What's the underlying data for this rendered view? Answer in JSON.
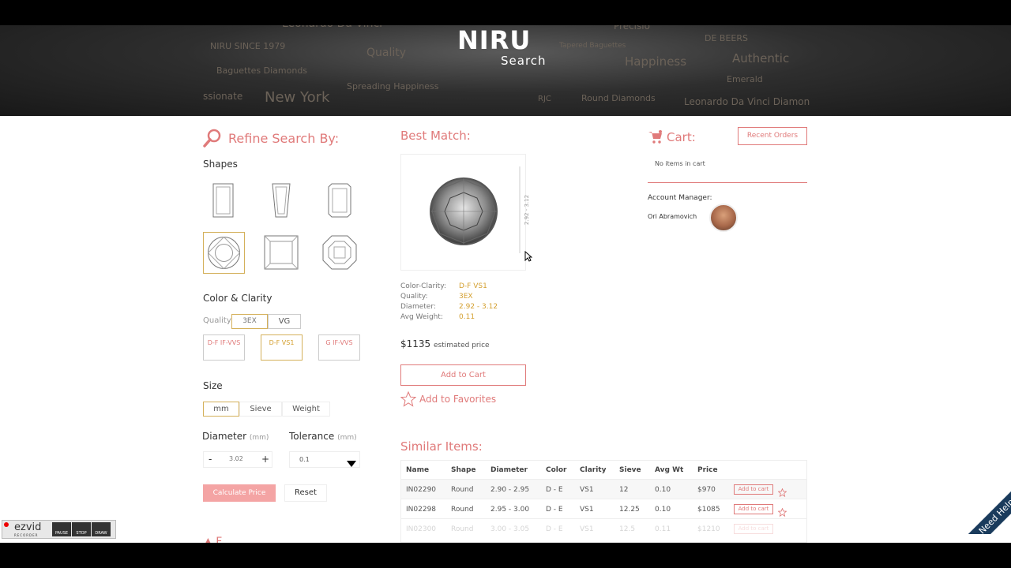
{
  "hero": {
    "logo": "NIRU",
    "subtitle": "Search",
    "words": [
      "Precisio",
      "NIRU SINCE 1979",
      "Quality",
      "Tapered Baguettes",
      "Happiness",
      "Authentic",
      "DE BEERS",
      "Baguettes Diamonds",
      "Spreading Happiness",
      "Emerald",
      "ssionate",
      "New York",
      "RJC",
      "Round Diamonds",
      "Leonardo Da Vinci Diamon"
    ]
  },
  "refine": {
    "title": "Refine Search By:",
    "shapes_label": "Shapes",
    "color_clarity_label": "Color & Clarity",
    "quality_label": "Quality",
    "quality_options": [
      "3EX",
      "VG"
    ],
    "clarity_options": [
      "D-F IF-VVS",
      "D-F VS1",
      "G IF-VVS"
    ],
    "size_label": "Size",
    "size_options": [
      "mm",
      "Sieve",
      "Weight"
    ],
    "diameter_label": "Diameter",
    "diameter_unit": "(mm)",
    "tolerance_label": "Tolerance",
    "tolerance_unit": "(mm)",
    "minus": "-",
    "plus": "+",
    "diameter_value": "3.02",
    "tolerance_value": "0.1",
    "calculate_label": "Calculate Price",
    "reset_label": "Reset"
  },
  "best": {
    "title": "Best Match:",
    "dimension_label": "2.92 - 3.12",
    "details": [
      {
        "key": "Color-Clarity:",
        "val": "D-F VS1"
      },
      {
        "key": "Quality:",
        "val": "3EX"
      },
      {
        "key": "Diameter:",
        "val": "2.92 - 3.12"
      },
      {
        "key": "Avg Weight:",
        "val": "0.11"
      }
    ],
    "price": "$1135",
    "price_note": "estimated price",
    "add_to_cart": "Add to Cart",
    "add_to_favorites": "Add to Favorites"
  },
  "cart": {
    "title": "Cart:",
    "recent_orders": "Recent Orders",
    "empty_text": "No items in cart",
    "manager_label": "Account Manager:",
    "manager_name": "Ori Abramovich"
  },
  "similar": {
    "title": "Similar Items:",
    "headers": [
      "Name",
      "Shape",
      "Diameter",
      "Color",
      "Clarity",
      "Sieve",
      "Avg Wt",
      "Price"
    ],
    "rows": [
      {
        "name": "IN02290",
        "shape": "Round",
        "diameter": "2.90 - 2.95",
        "color": "D - E",
        "clarity": "VS1",
        "sieve": "12",
        "avg": "0.10",
        "price": "$970"
      },
      {
        "name": "IN02298",
        "shape": "Round",
        "diameter": "2.95 - 3.00",
        "color": "D - E",
        "clarity": "VS1",
        "sieve": "12.25",
        "avg": "0.10",
        "price": "$1085"
      },
      {
        "name": "IN02300",
        "shape": "Round",
        "diameter": "3.00 - 3.05",
        "color": "D - E",
        "clarity": "VS1",
        "sieve": "12.5",
        "avg": "0.11",
        "price": "$1210"
      }
    ],
    "add_label": "Add to cart"
  },
  "help": "Need Help",
  "recorder": {
    "brand": "ezvid",
    "sub": "RECORDER",
    "buttons": [
      "PAUSE",
      "STOP",
      "DRAW"
    ]
  },
  "colors": {
    "accent": "#e07a7a",
    "gold": "#d4b05a"
  }
}
